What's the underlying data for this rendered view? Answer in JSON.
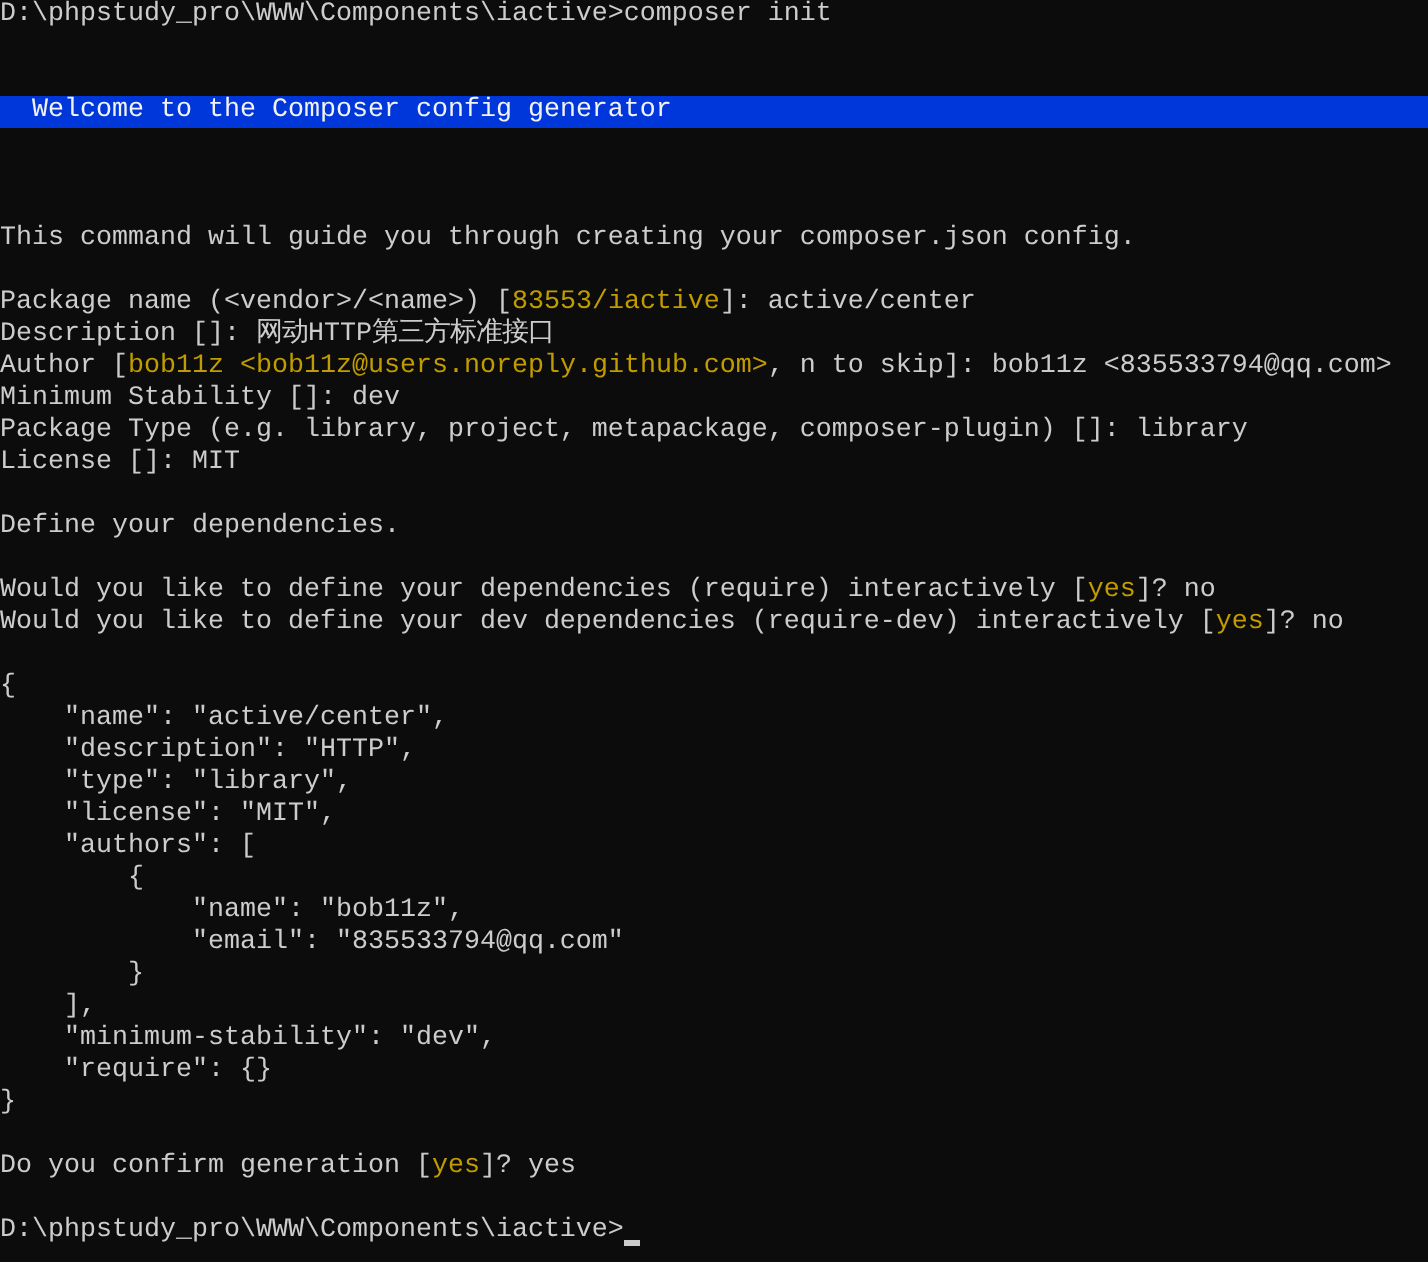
{
  "terminal": {
    "lines": [
      {
        "kind": "text",
        "segments": [
          {
            "kind": "plain",
            "text": "D:\\phpstudy_pro\\WWW\\Components\\iactive>composer init"
          }
        ]
      },
      {
        "kind": "blank"
      },
      {
        "kind": "blank"
      },
      {
        "kind": "banner",
        "segments": [
          {
            "kind": "plain",
            "text": "Welcome to the Composer config generator"
          }
        ]
      },
      {
        "kind": "blank"
      },
      {
        "kind": "blank"
      },
      {
        "kind": "blank"
      },
      {
        "kind": "text",
        "segments": [
          {
            "kind": "plain",
            "text": "This command will guide you through creating your composer.json config."
          }
        ]
      },
      {
        "kind": "blank"
      },
      {
        "kind": "text",
        "segments": [
          {
            "kind": "plain",
            "text": "Package name (<vendor>/<name>) ["
          },
          {
            "kind": "highlight",
            "text": "83553/iactive"
          },
          {
            "kind": "plain",
            "text": "]: active/center"
          }
        ]
      },
      {
        "kind": "text",
        "segments": [
          {
            "kind": "plain",
            "text": "Description []: 网动HTTP第三方标准接口"
          }
        ]
      },
      {
        "kind": "text",
        "segments": [
          {
            "kind": "plain",
            "text": "Author ["
          },
          {
            "kind": "highlight",
            "text": "bob11z <bob11z@users.noreply.github.com>"
          },
          {
            "kind": "plain",
            "text": ", n to skip]: bob11z <835533794@qq.com>"
          }
        ]
      },
      {
        "kind": "text",
        "segments": [
          {
            "kind": "plain",
            "text": "Minimum Stability []: dev"
          }
        ]
      },
      {
        "kind": "text",
        "segments": [
          {
            "kind": "plain",
            "text": "Package Type (e.g. library, project, metapackage, composer-plugin) []: library"
          }
        ]
      },
      {
        "kind": "text",
        "segments": [
          {
            "kind": "plain",
            "text": "License []: MIT"
          }
        ]
      },
      {
        "kind": "blank"
      },
      {
        "kind": "text",
        "segments": [
          {
            "kind": "plain",
            "text": "Define your dependencies."
          }
        ]
      },
      {
        "kind": "blank"
      },
      {
        "kind": "text",
        "segments": [
          {
            "kind": "plain",
            "text": "Would you like to define your dependencies (require) interactively ["
          },
          {
            "kind": "highlight",
            "text": "yes"
          },
          {
            "kind": "plain",
            "text": "]? no"
          }
        ]
      },
      {
        "kind": "text",
        "segments": [
          {
            "kind": "plain",
            "text": "Would you like to define your dev dependencies (require-dev) interactively ["
          },
          {
            "kind": "highlight",
            "text": "yes"
          },
          {
            "kind": "plain",
            "text": "]? no"
          }
        ]
      },
      {
        "kind": "blank"
      },
      {
        "kind": "text",
        "segments": [
          {
            "kind": "plain",
            "text": "{"
          }
        ]
      },
      {
        "kind": "text",
        "segments": [
          {
            "kind": "plain",
            "text": "    \"name\": \"active/center\","
          }
        ]
      },
      {
        "kind": "text",
        "segments": [
          {
            "kind": "plain",
            "text": "    \"description\": \"HTTP\","
          }
        ]
      },
      {
        "kind": "text",
        "segments": [
          {
            "kind": "plain",
            "text": "    \"type\": \"library\","
          }
        ]
      },
      {
        "kind": "text",
        "segments": [
          {
            "kind": "plain",
            "text": "    \"license\": \"MIT\","
          }
        ]
      },
      {
        "kind": "text",
        "segments": [
          {
            "kind": "plain",
            "text": "    \"authors\": ["
          }
        ]
      },
      {
        "kind": "text",
        "segments": [
          {
            "kind": "plain",
            "text": "        {"
          }
        ]
      },
      {
        "kind": "text",
        "segments": [
          {
            "kind": "plain",
            "text": "            \"name\": \"bob11z\","
          }
        ]
      },
      {
        "kind": "text",
        "segments": [
          {
            "kind": "plain",
            "text": "            \"email\": \"835533794@qq.com\""
          }
        ]
      },
      {
        "kind": "text",
        "segments": [
          {
            "kind": "plain",
            "text": "        }"
          }
        ]
      },
      {
        "kind": "text",
        "segments": [
          {
            "kind": "plain",
            "text": "    ],"
          }
        ]
      },
      {
        "kind": "text",
        "segments": [
          {
            "kind": "plain",
            "text": "    \"minimum-stability\": \"dev\","
          }
        ]
      },
      {
        "kind": "text",
        "segments": [
          {
            "kind": "plain",
            "text": "    \"require\": {}"
          }
        ]
      },
      {
        "kind": "text",
        "segments": [
          {
            "kind": "plain",
            "text": "}"
          }
        ]
      },
      {
        "kind": "blank"
      },
      {
        "kind": "text",
        "segments": [
          {
            "kind": "plain",
            "text": "Do you confirm generation ["
          },
          {
            "kind": "highlight",
            "text": "yes"
          },
          {
            "kind": "plain",
            "text": "]? yes"
          }
        ]
      },
      {
        "kind": "blank"
      },
      {
        "kind": "text",
        "cursor": true,
        "segments": [
          {
            "kind": "plain",
            "text": "D:\\phpstudy_pro\\WWW\\Components\\iactive>"
          }
        ]
      }
    ]
  }
}
